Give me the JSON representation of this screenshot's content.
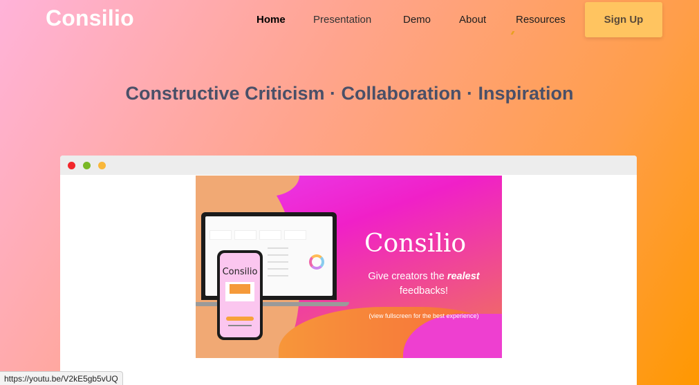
{
  "brand": {
    "logo": "Consilio"
  },
  "nav": {
    "items": [
      {
        "label": "Home",
        "active": true
      },
      {
        "label": "Presentation",
        "active": false
      },
      {
        "label": "Demo",
        "active": false
      },
      {
        "label": "About",
        "active": false
      },
      {
        "label": "Resources",
        "active": false
      }
    ],
    "signup_label": "Sign Up"
  },
  "hero": {
    "tagline": "Constructive Criticism · Collaboration · Inspiration"
  },
  "video": {
    "title": "Consilio",
    "subtitle_prefix": "Give creators the ",
    "subtitle_emphasis": "realest",
    "subtitle_suffix": " feedbacks!",
    "note": "(view fullscreen for the best experience)",
    "phone_logo": "Consilio"
  },
  "status": {
    "url": "https://youtu.be/V2kE5gb5vUQ"
  },
  "colors": {
    "signup_bg": "#ffc460",
    "tagline": "#4a5068",
    "dot_red": "#f2262b",
    "dot_green": "#7ab826",
    "dot_yellow": "#f9b73a"
  }
}
